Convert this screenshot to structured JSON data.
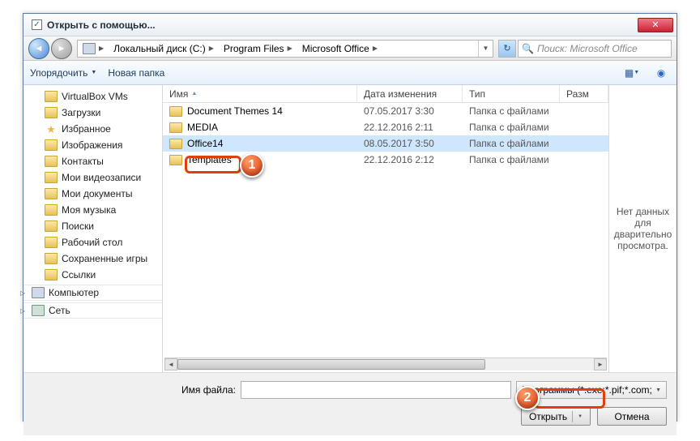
{
  "title": "Открыть с помощью...",
  "breadcrumbs": {
    "seg0": "",
    "seg1": "Локальный диск (C:)",
    "seg2": "Program Files",
    "seg3": "Microsoft Office"
  },
  "search": {
    "placeholder": "Поиск: Microsoft Office"
  },
  "cmdbar": {
    "organize": "Упорядочить",
    "newfolder": "Новая папка"
  },
  "tree": {
    "items": [
      "VirtualBox VMs",
      "Загрузки",
      "Избранное",
      "Изображения",
      "Контакты",
      "Мои видеозаписи",
      "Мои документы",
      "Моя музыка",
      "Поиски",
      "Рабочий стол",
      "Сохраненные игры",
      "Ссылки"
    ],
    "computer": "Компьютер",
    "network": "Сеть"
  },
  "columns": {
    "name": "Имя",
    "date": "Дата изменения",
    "type": "Тип",
    "size": "Разм"
  },
  "rows": [
    {
      "name": "Document Themes 14",
      "date": "07.05.2017 3:30",
      "type": "Папка с файлами"
    },
    {
      "name": "MEDIA",
      "date": "22.12.2016 2:11",
      "type": "Папка с файлами"
    },
    {
      "name": "Office14",
      "date": "08.05.2017 3:50",
      "type": "Папка с файлами"
    },
    {
      "name": "Templates",
      "date": "22.12.2016 2:12",
      "type": "Папка с файлами"
    }
  ],
  "preview": "Нет данных для дварительно просмотра.",
  "bottom": {
    "fnlabel": "Имя файла:",
    "filter": "Программы (*.exe;*.pif;*.com;",
    "open": "Открыть",
    "cancel": "Отмена"
  },
  "markers": {
    "one": "1",
    "two": "2"
  }
}
